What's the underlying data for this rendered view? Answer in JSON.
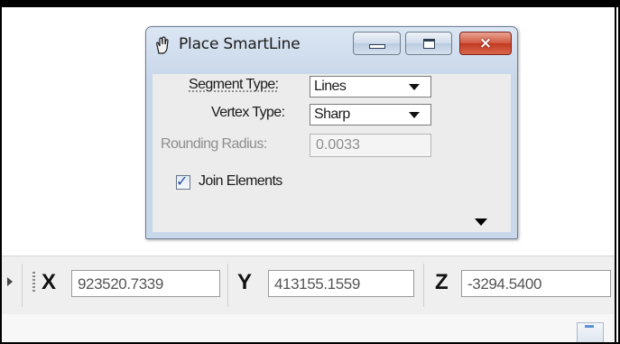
{
  "dialog": {
    "title": "Place SmartLine",
    "title_icon": "smartline-hand-icon",
    "window_buttons": {
      "minimize": "minimize-icon",
      "maximize": "maximize-icon",
      "close": "×"
    },
    "segment_type": {
      "label": "Segment Type:",
      "value": "Lines"
    },
    "vertex_type": {
      "label": "Vertex Type:",
      "value": "Sharp"
    },
    "rounding_radius": {
      "label": "Rounding Radius:",
      "value": "0.0033"
    },
    "join_elements": {
      "label": "Join Elements",
      "checked": true
    }
  },
  "coordinates": {
    "x_label": "X",
    "x_value": "923520.7339",
    "y_label": "Y",
    "y_value": "413155.1559",
    "z_label": "Z",
    "z_value": "-3294.5400"
  },
  "colors": {
    "close_button": "#c8432a",
    "title_gradient": "#c8d7ea"
  }
}
